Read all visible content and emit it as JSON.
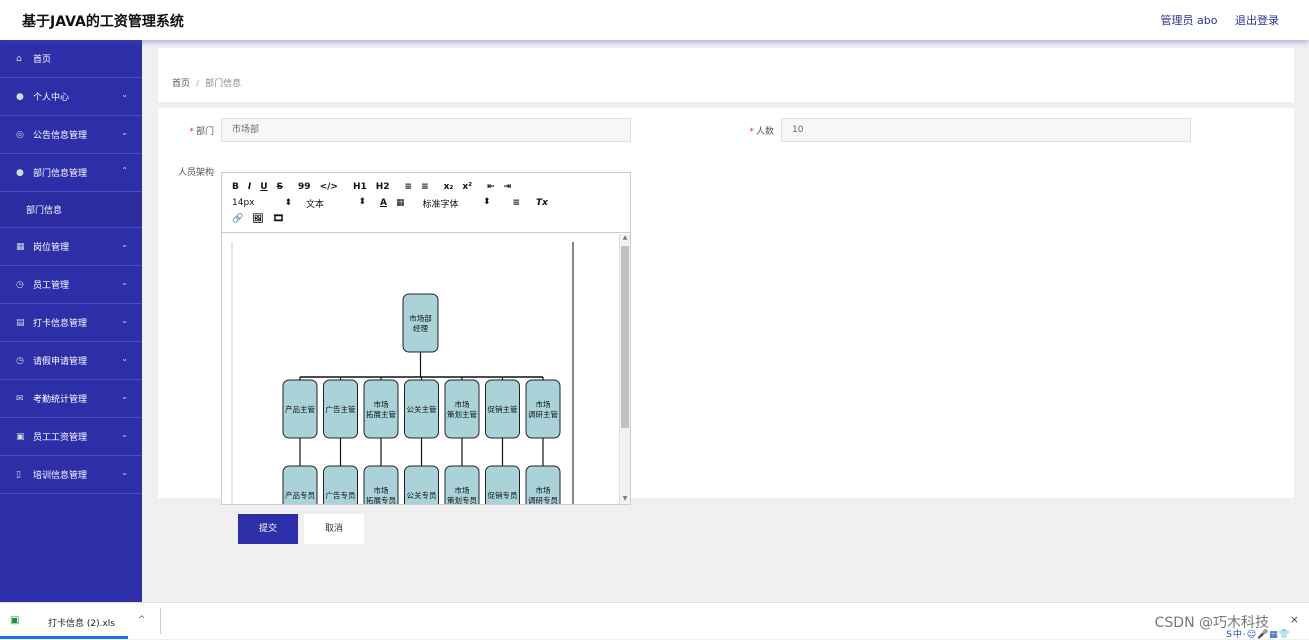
{
  "header": {
    "title": "基于JAVA的工资管理系统",
    "user": "管理员 abo",
    "logout": "退出登录"
  },
  "sidebar": {
    "items": [
      {
        "label": "首页"
      },
      {
        "label": "个人中心"
      },
      {
        "label": "公告信息管理"
      },
      {
        "label": "部门信息管理"
      },
      {
        "label": "部门信息"
      },
      {
        "label": "岗位管理"
      },
      {
        "label": "员工管理"
      },
      {
        "label": "打卡信息管理"
      },
      {
        "label": "请假申请管理"
      },
      {
        "label": "考勤统计管理"
      },
      {
        "label": "员工工资管理"
      },
      {
        "label": "培训信息管理"
      }
    ]
  },
  "breadcrumb": {
    "home": "首页",
    "separator": "/",
    "current": "部门信息"
  },
  "form": {
    "dept_label": "部门",
    "dept_value": "市场部",
    "count_label": "人数",
    "count_value": "10",
    "structure_label": "人员架构",
    "required_mark": "*"
  },
  "editor": {
    "toolbar_row1": [
      "B",
      "I",
      "U",
      "S",
      "99",
      "</>",
      "H1",
      "H2",
      "≡",
      "≡",
      "x₂",
      "x²",
      "⇤",
      "⇥"
    ],
    "font_size": "14px",
    "text_style": "文本",
    "font_family": "标准字体",
    "select_arrow": "⬍",
    "color_icons": [
      "A",
      "▦"
    ],
    "align_icon": "≡",
    "clear_icon": "Tx",
    "toolbar_row3": [
      "🔗",
      "🖼",
      "🎞"
    ]
  },
  "org_chart": {
    "manager": "市场部\n经理",
    "supervisors": [
      "产品主管",
      "广告主管",
      "市场\n拓展主管",
      "公关主管",
      "市场\n策划主管",
      "促销主管",
      "市场\n调研主管"
    ],
    "specialists": [
      "产品专员",
      "广告专员",
      "市场\n拓展专员",
      "公关专员",
      "市场\n策划专员",
      "促销专员",
      "市场\n调研专员"
    ]
  },
  "buttons": {
    "submit": "提交",
    "cancel": "取消"
  },
  "download": {
    "filename": "打卡信息 (2).xls",
    "chevron": "^",
    "close": "×"
  },
  "watermark": "CSDN @巧木科技",
  "colors": {
    "primary": "#2d2fa8",
    "org_box": "#a9d3d8"
  }
}
